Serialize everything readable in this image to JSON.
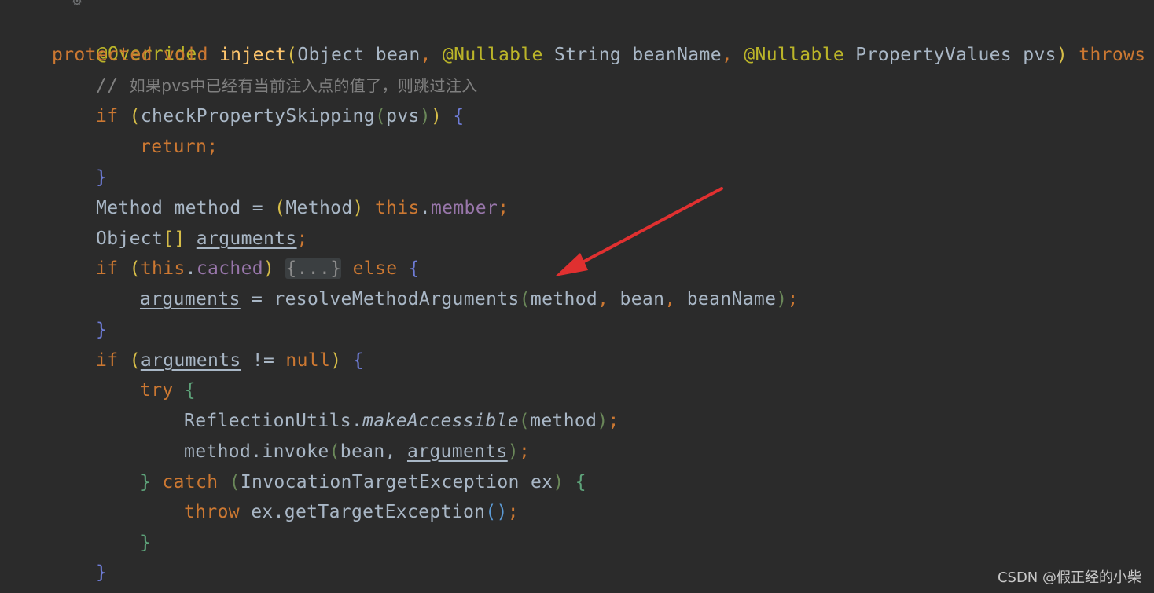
{
  "editor": {
    "language": "Java",
    "theme_colors": {
      "background": "#2b2b2b",
      "keyword": "#cc7832",
      "annotation": "#bbb529",
      "method_decl": "#ffc66d",
      "field": "#9876aa",
      "comment": "#808080",
      "text": "#a9b7c6"
    },
    "lines": {
      "l1": {
        "ann": "@Override"
      },
      "l2": {
        "kw1": "protected",
        "kw2": "void",
        "name": "inject",
        "open": "(",
        "t1": "Object bean",
        "comma1": ",",
        "ann1": "@Nullable",
        "t2": "String beanName",
        "comma2": ",",
        "ann2": "@Nullable",
        "t3": "PropertyValues pvs",
        "close": ")",
        "kw3": "throws",
        "rest": "T"
      },
      "l3": {
        "slashes": "//",
        "text": "如果pvs中已经有当前注入点的值了，则跳过注入"
      },
      "l4": {
        "kw": "if",
        "p1": "(",
        "call": "checkPropertySkipping",
        "p2": "(",
        "arg": "pvs",
        "p3": ")",
        "p4": ")",
        "brace": "{"
      },
      "l5": {
        "kw": "return",
        "semi": ";"
      },
      "l6": {
        "brace": "}"
      },
      "l7": {
        "t1": "Method method = ",
        "p1": "(",
        "cast": "Method",
        "p2": ")",
        "kw": "this",
        "dot": ".",
        "field": "member",
        "semi": ";"
      },
      "l8": {
        "t1": "Object",
        "br": "[]",
        "var": "arguments",
        "semi": ";"
      },
      "l9": {
        "kw": "if",
        "p1": "(",
        "kw2": "this",
        "dot": ".",
        "field": "cached",
        "p2": ")",
        "fold": "{...}",
        "kw3": "else",
        "brace": "{"
      },
      "l10": {
        "var": "arguments",
        "t1": " = resolveMethodArguments",
        "p1": "(",
        "a1": "method",
        "c1": ",",
        "a2": "bean",
        "c2": ",",
        "a3": "beanName",
        "p2": ")",
        "semi": ";"
      },
      "l11": {
        "brace": "}"
      },
      "l12": {
        "kw": "if",
        "p1": "(",
        "var": "arguments",
        "op": " != ",
        "kw2": "null",
        "p2": ")",
        "brace": "{"
      },
      "l13": {
        "kw": "try",
        "brace": "{"
      },
      "l14": {
        "cls": "ReflectionUtils.",
        "call": "makeAccessible",
        "p1": "(",
        "arg": "method",
        "p2": ")",
        "semi": ";"
      },
      "l15": {
        "t1": "method.invoke",
        "p1": "(",
        "a1": "bean, ",
        "var": "arguments",
        "p2": ")",
        "semi": ";"
      },
      "l16": {
        "brace1": "}",
        "kw": "catch",
        "p1": "(",
        "t1": "InvocationTargetException ex",
        "p2": ")",
        "brace2": "{"
      },
      "l17": {
        "kw": "throw",
        "t1": " ex.getTargetException",
        "p": "()",
        "semi": ";"
      },
      "l18": {
        "brace": "}"
      },
      "l19": {
        "brace": "}"
      }
    }
  },
  "annotation": {
    "arrow_color": "#e03030"
  },
  "watermark": {
    "text": "CSDN @假正经的小柴"
  }
}
